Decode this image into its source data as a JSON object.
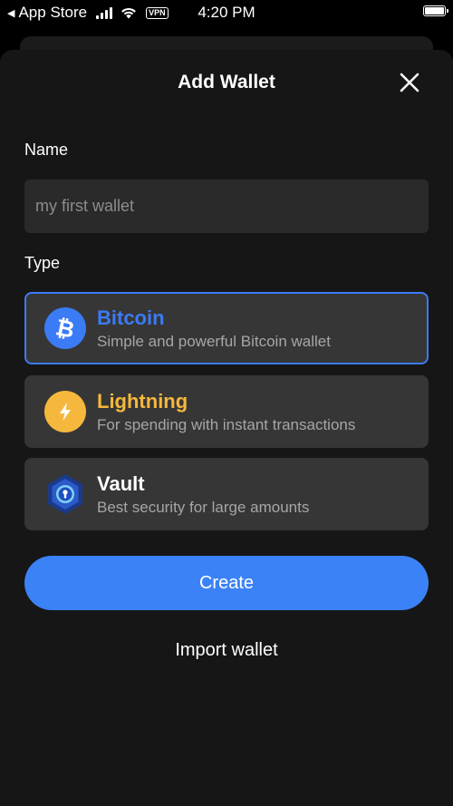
{
  "status_bar": {
    "back_app": "App Store",
    "vpn": "VPN",
    "time": "4:20 PM"
  },
  "sheet": {
    "title": "Add Wallet",
    "close_icon": "close-icon"
  },
  "form": {
    "name_label": "Name",
    "name_placeholder": "my first wallet",
    "name_value": "",
    "type_label": "Type",
    "types": [
      {
        "name": "Bitcoin",
        "description": "Simple and powerful Bitcoin wallet",
        "color": "#3b7bf5",
        "icon": "bitcoin-icon",
        "selected": true
      },
      {
        "name": "Lightning",
        "description": "For spending with instant transactions",
        "color": "#f5b83d",
        "icon": "lightning-icon",
        "selected": false
      },
      {
        "name": "Vault",
        "description": "Best security for large amounts",
        "color": "#ffffff",
        "icon": "vault-icon",
        "selected": false
      }
    ]
  },
  "actions": {
    "create_label": "Create",
    "import_label": "Import wallet"
  },
  "colors": {
    "accent": "#3b82f6",
    "lightning": "#f5b83d",
    "background": "#161616",
    "card": "#363636"
  }
}
